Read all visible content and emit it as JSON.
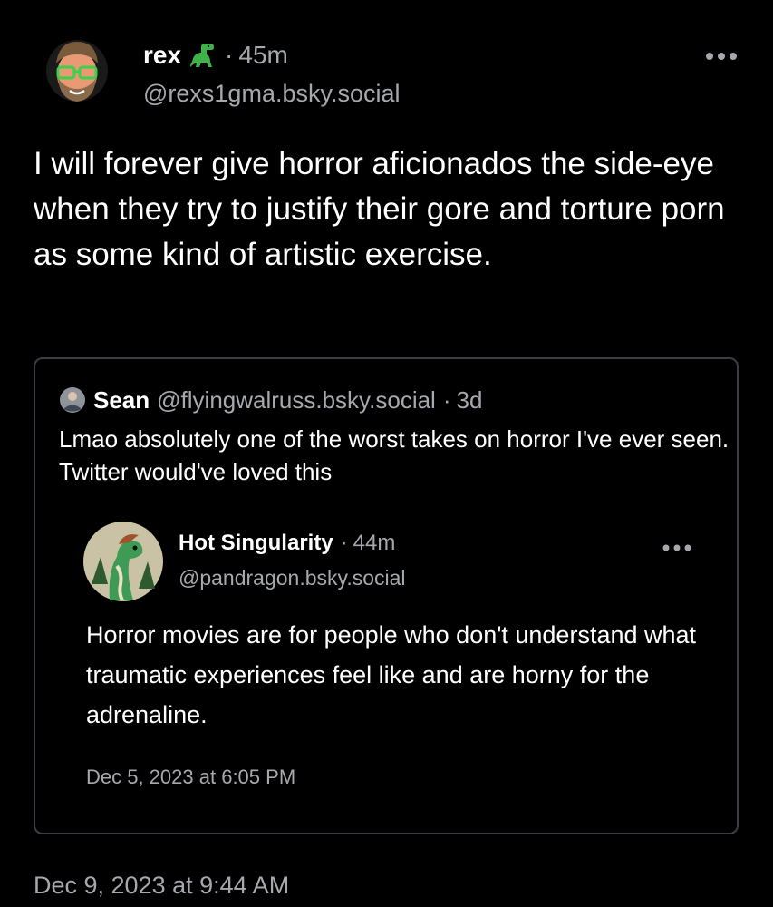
{
  "post": {
    "author_name": "rex",
    "author_emoji_icon": "dinosaur-icon",
    "dot": "·",
    "time_ago": "45m",
    "handle": "@rexs1gma.bsky.social",
    "more_icon": "ellipsis-icon",
    "text": "I will forever give horror aficionados the side-eye when they try to justify their gore and torture porn as some kind of artistic exercise.",
    "date": "Dec 9, 2023 at 9:44 AM"
  },
  "quote": {
    "author_name": "Sean",
    "handle": "@flyingwalruss.bsky.social",
    "dot": "·",
    "time_ago": "3d",
    "text": "Lmao absolutely one of the worst takes on horror I've ever seen. Twitter would've loved this"
  },
  "embedded": {
    "author_name": "Hot Singularity",
    "dot": "·",
    "time_ago": "44m",
    "handle": "@pandragon.bsky.social",
    "more_icon": "ellipsis-icon",
    "text": "Horror movies are for people who don't understand what traumatic experiences feel like and are horny for the adrenaline.",
    "date": "Dec 5, 2023 at 6:05 PM"
  },
  "colors": {
    "background": "#000000",
    "text": "#ffffff",
    "muted": "#a6a8ad",
    "border": "#3a3d44"
  }
}
